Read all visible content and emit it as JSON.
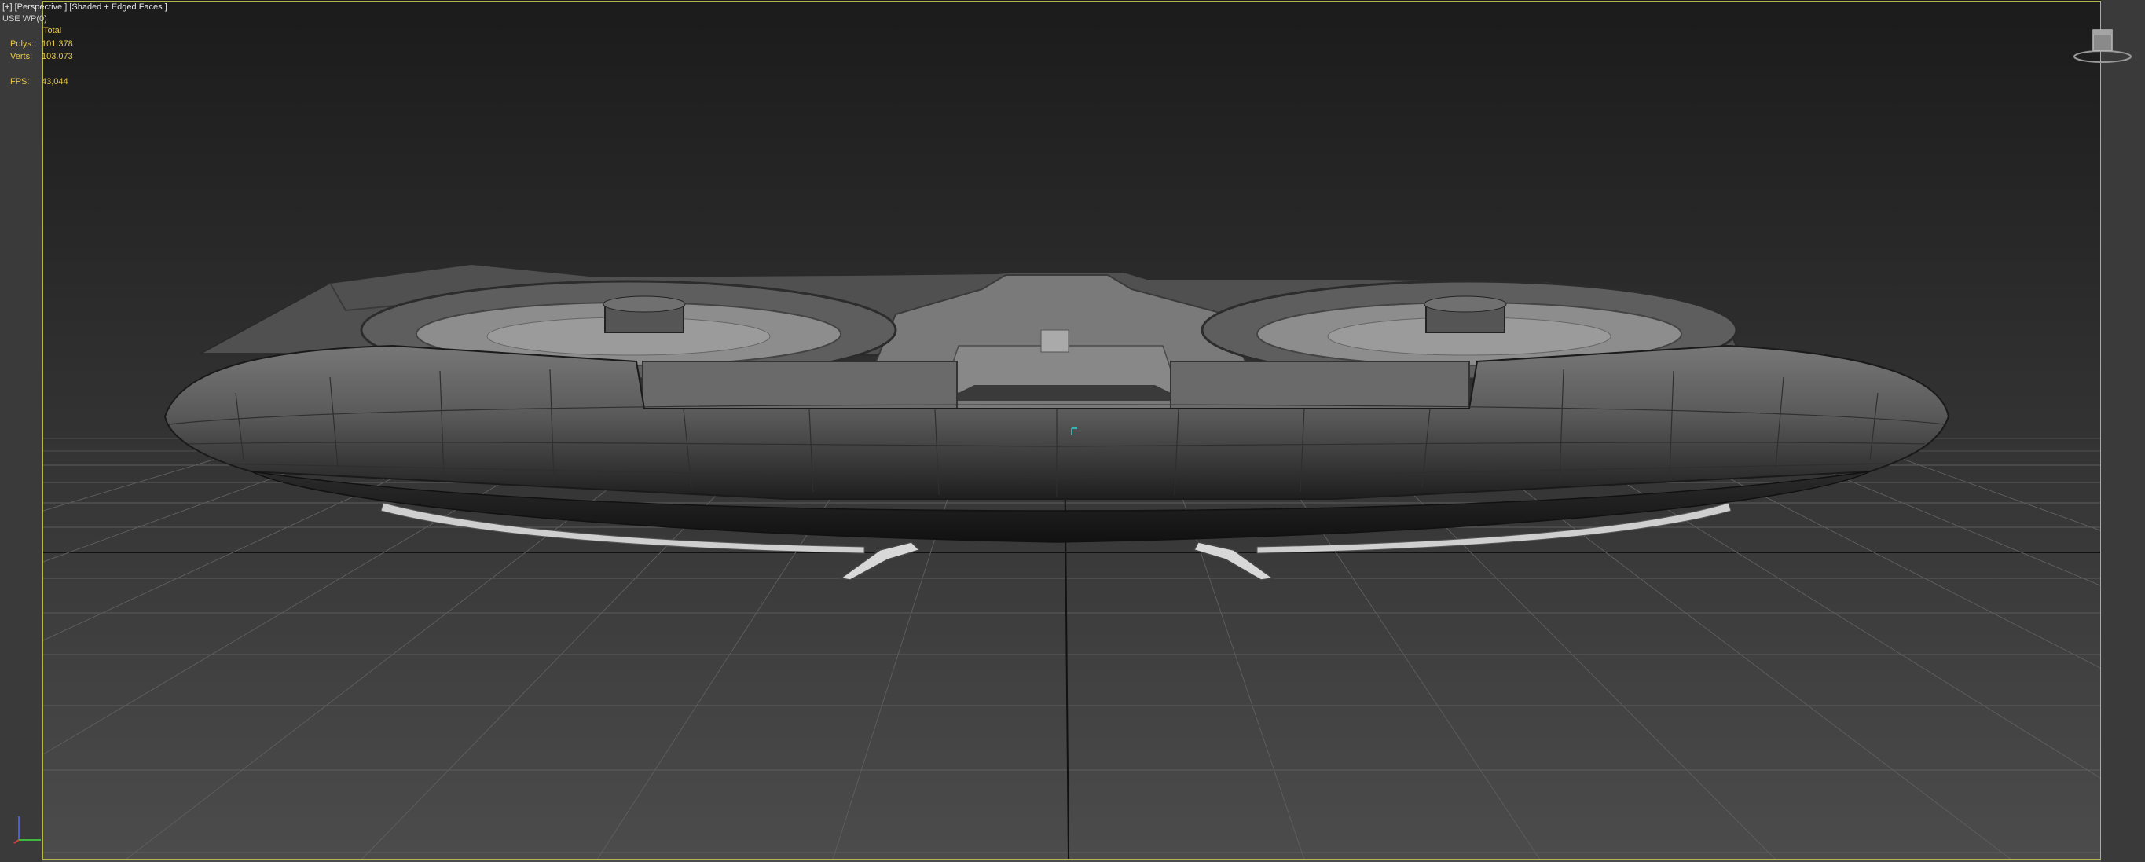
{
  "viewport": {
    "menu": {
      "plus": "[+]",
      "view": "[Perspective ]",
      "shading": "[Shaded + Edged Faces ]"
    },
    "wp_label": "USE WP(0)",
    "stats": {
      "header": "Total",
      "polys_label": "Polys:",
      "polys_value": "101.378",
      "verts_label": "Verts:",
      "verts_value": "103.073",
      "fps_label": "FPS:",
      "fps_value": "43,044"
    },
    "frame_color": "#b5b54a",
    "stat_color": "#e5c84a",
    "background_top": "#1d1d1d",
    "background_bottom": "#4a4a4a"
  },
  "viewcube": {
    "icon": "viewcube-icon"
  },
  "axis_tripod": {
    "icon": "axis-tripod-icon"
  }
}
